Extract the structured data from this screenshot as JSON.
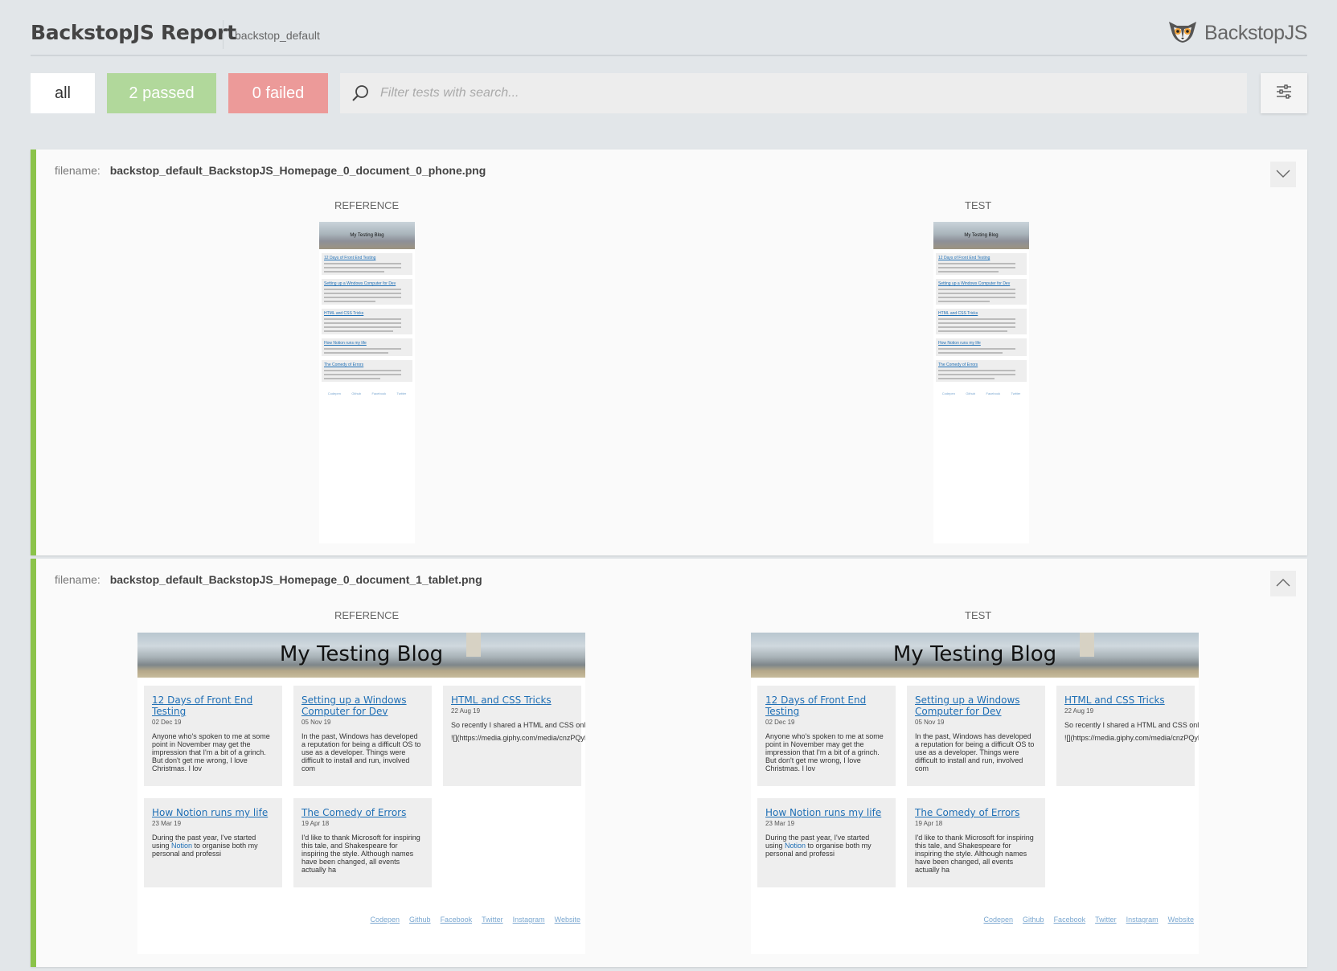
{
  "header": {
    "title": "BackstopJS Report",
    "config_name": "backstop_default",
    "brand": "BackstopJS"
  },
  "toolbar": {
    "all_label": "all",
    "passed_label": "2 passed",
    "failed_label": "0 failed",
    "search_placeholder": "Filter tests with search...",
    "search_value": ""
  },
  "colors": {
    "passed": "#b1d89b",
    "failed": "#ec9a99",
    "pass_border": "#8bc34a",
    "link": "#1f6fb5"
  },
  "tests": [
    {
      "filename_label": "filename:",
      "filename": "backstop_default_BackstopJS_Homepage_0_document_0_phone.png",
      "reference_label": "REFERENCE",
      "test_label": "TEST",
      "expanded": false,
      "toggle_icon": "chevron-down-icon"
    },
    {
      "filename_label": "filename:",
      "filename": "backstop_default_BackstopJS_Homepage_0_document_1_tablet.png",
      "reference_label": "REFERENCE",
      "test_label": "TEST",
      "expanded": true,
      "toggle_icon": "chevron-up-icon"
    }
  ],
  "screenshot_content": {
    "blog_title": "My Testing Blog",
    "posts": [
      {
        "title": "12 Days of Front End Testing",
        "date": "02 Dec 19",
        "excerpt": "Anyone who's spoken to me at some point in November may get the impression that I'm a bit of a grinch. But don't get me wrong, I love Christmas. I lov"
      },
      {
        "title": "Setting up a Windows Computer for Dev",
        "date": "05 Nov 19",
        "excerpt": "In the past, Windows has developed a reputation for being a difficult OS to use as a developer. Things were difficult to install and run, involved com"
      },
      {
        "title": "HTML and CSS Tricks",
        "date": "22 Aug 19",
        "excerpt": "So recently I shared a HTML and CSS only test carousel, and was accused of witchcraft 😮",
        "excerpt2": "![](https://media.giphy.com/media/cnzPQyHVW"
      },
      {
        "title": "How Notion runs my life",
        "date": "23 Mar 19",
        "excerpt_pre": "During the past year, I've started using ",
        "excerpt_link": "Notion",
        "excerpt_post": " to organise both my personal and professi"
      },
      {
        "title": "The Comedy of Errors",
        "date": "19 Apr 18",
        "excerpt": "I'd like to thank Microsoft for inspiring this tale, and Shakespeare for inspiring the style. Although names have been changed, all events actually ha"
      }
    ],
    "footer_links": [
      "Codepen",
      "Github",
      "Facebook",
      "Twitter",
      "Instagram",
      "Website"
    ]
  }
}
